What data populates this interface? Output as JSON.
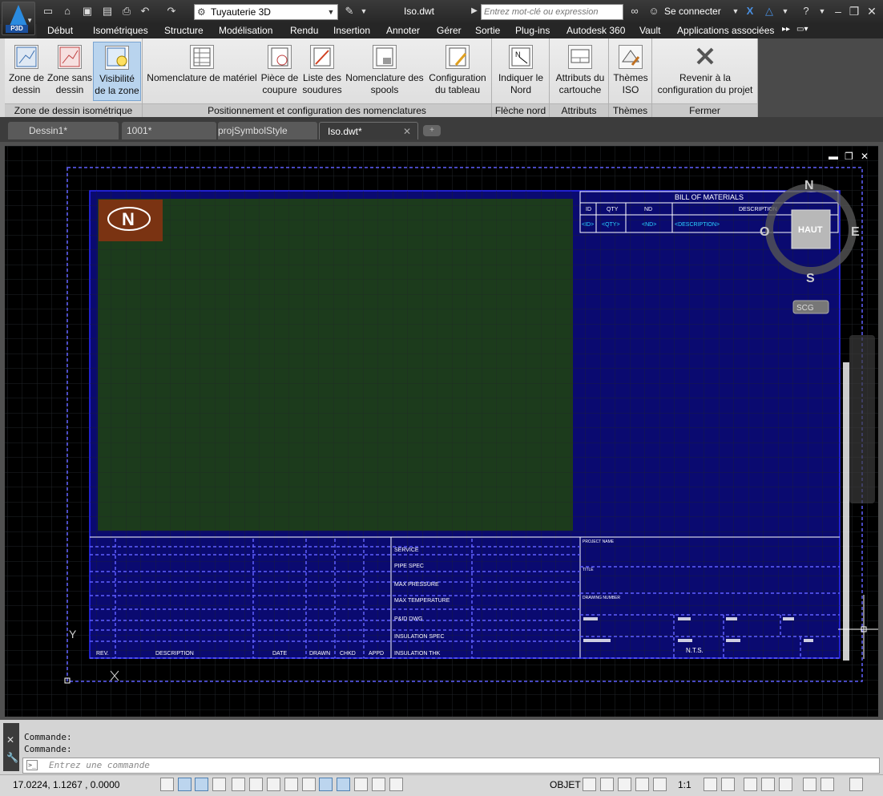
{
  "app": {
    "badge": "P3D",
    "workspace": "Tuyauterie 3D",
    "file_title": "Iso.dwt",
    "search_placeholder": "Entrez mot-clé ou expression",
    "signin": "Se connecter"
  },
  "menu": [
    "Début",
    "Isométriques",
    "Structure",
    "Modélisation",
    "Rendu",
    "Insertion",
    "Annoter",
    "Gérer",
    "Sortie",
    "Plug-ins",
    "Autodesk 360",
    "Vault",
    "Applications associées"
  ],
  "ribbon": {
    "panels": [
      {
        "title": "Zone de dessin isométrique"
      },
      {
        "title": "Positionnement et configuration des nomenclatures"
      },
      {
        "title": "Flèche nord"
      },
      {
        "title": "Attributs"
      },
      {
        "title": "Thèmes"
      },
      {
        "title": "Fermer"
      }
    ],
    "buttons": [
      {
        "label": "Zone de\ndessin"
      },
      {
        "label": "Zone sans\ndessin"
      },
      {
        "label": "Visibilité\nde la zone"
      },
      {
        "label": "Nomenclature de matériel"
      },
      {
        "label": "Pièce de\ncoupure"
      },
      {
        "label": "Liste des\nsoudures"
      },
      {
        "label": "Nomenclature des\nspools"
      },
      {
        "label": "Configuration\ndu tableau"
      },
      {
        "label": "Indiquer le\nNord"
      },
      {
        "label": "Attributs du\ncartouche"
      },
      {
        "label": "Thèmes\nISO"
      },
      {
        "label": "Revenir à la\nconfiguration du projet"
      }
    ]
  },
  "tabs": [
    {
      "label": "Dessin1*"
    },
    {
      "label": "1001*"
    },
    {
      "label": "projSymbolStyle"
    },
    {
      "label": "Iso.dwt*"
    }
  ],
  "drawing": {
    "bom_title": "BILL OF MATERIALS",
    "bom_headers": [
      "ID",
      "QTY",
      "ND",
      "DESCRIPTION"
    ],
    "bom_row": [
      "<ID>",
      "<QTY>",
      "<ND>",
      "<DESCRIPTION>"
    ],
    "north_letter": "N",
    "spec_labels": [
      "SERVICE",
      "PIPE SPEC",
      "MAX PRESSURE",
      "MAX TEMPERATURE",
      "P&ID DWG",
      "INSULATION SPEC",
      "INSULATION THK"
    ],
    "rev_headers": [
      "REV.",
      "DESCRIPTION",
      "DATE",
      "DRAWN",
      "CHKD",
      "APPD"
    ],
    "title_labels": [
      "PROJECT NAME",
      "TITLE",
      "DRAWING NUMBER"
    ],
    "nts": "N.T.S.",
    "ucs_y": "Y",
    "viewcube": {
      "n": "N",
      "s": "S",
      "e": "E",
      "w": "O",
      "face": "HAUT",
      "wcs": "SCG"
    }
  },
  "command": {
    "history": [
      "Commande:",
      "Commande:"
    ],
    "placeholder": "Entrez une commande"
  },
  "status": {
    "coords": "17.0224, 1.1267 , 0.0000",
    "object": "OBJET",
    "scale": "1:1"
  }
}
